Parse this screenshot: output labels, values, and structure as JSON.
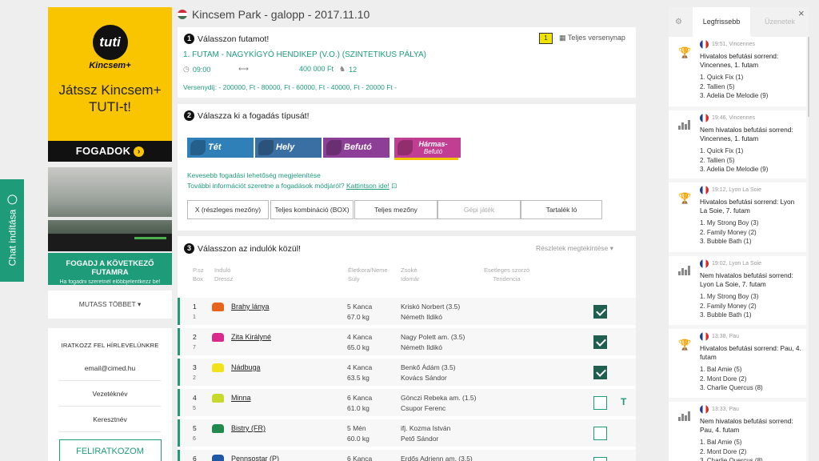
{
  "chat": {
    "label": "Chat indítása"
  },
  "ad": {
    "logo": "tuti",
    "brand": "Kincsem+",
    "slogan_line1": "Játssz Kincsem+",
    "slogan_line2": "TUTI-t!",
    "cta": "FOGADOK"
  },
  "bet_next": {
    "title": "FOGADJ A KÖVETKEZŐ FUTAMRA",
    "subtitle": "Ha fogadni szeretnél előbbjelentkezz be!"
  },
  "more": {
    "label": "MUTASS TÖBBET"
  },
  "newsletter": {
    "heading": "IRATKOZZ FEL HÍRLEVELÜNKRE",
    "email": "email@cimed.hu",
    "lastname": "Vezetéknév",
    "firstname": "Keresztnév",
    "submit": "FELIRATKOZOM"
  },
  "header": {
    "title": "Kincsem Park - galopp - 2017.11.10"
  },
  "step1": {
    "num": "1",
    "title": "Válasszon futamot!",
    "race_name": "1. FUTAM - NAGYKÍGYÓ HENDIKEP (V.O.) (SZINTETIKUS PÁLYA)",
    "badge": "1",
    "full_program": "Teljes versenynap",
    "time": "09:00",
    "prize": "400 000 Ft",
    "runners": "12",
    "prizes_text": "Versenydíj: - 200000, Ft - 80000, Ft - 60000, Ft - 40000, Ft - 20000 Ft -"
  },
  "step2": {
    "num": "2",
    "title": "Válaszza ki a fogadás típusát!",
    "types": [
      "Tét",
      "Hely",
      "Befutó",
      "Hármas-",
      "Befutó"
    ],
    "link1": "Kevesebb fogadási lehetőség megjelenítése",
    "link2_prefix": "További információt szeretne a fogadások módjáról?",
    "link2": "Kattintson ide!",
    "options": [
      "X (részleges mezőny)",
      "Teljes kombináció (BOX)",
      "Teljes mezőny",
      "Gépi játék",
      "Tartalék ló"
    ]
  },
  "step3": {
    "num": "3",
    "title": "Válasszon az indulók közül!",
    "details": "Részletek megtekintése",
    "headers": {
      "pszl": "P.sz",
      "box": "Box",
      "indulo": "Induló",
      "dressz": "Dressz",
      "kor": "Életkora/Neme",
      "suly": "Súly",
      "zsoke": "Zsoké",
      "idomar": "Idomár",
      "szorzo": "Esetleges szorzó",
      "tendencia": "Tendencia"
    },
    "runners": [
      {
        "num": "1",
        "box": "1",
        "name": "Brahy lánya",
        "age": "5 Kanca",
        "weight": "67.0 kg",
        "jockey": "Kriskó Norbert (3.5)",
        "trainer": "Németh Ildikó",
        "silk": "#e8631c",
        "checked": true
      },
      {
        "num": "2",
        "box": "7",
        "name": "Zita Királyné",
        "age": "4 Kanca",
        "weight": "65.0 kg",
        "jockey": "Nagy Polett am. (3.5)",
        "trainer": "Németh Ildikó",
        "silk": "#d9298a",
        "checked": true
      },
      {
        "num": "3",
        "box": "2",
        "name": "Nádbuga",
        "age": "4 Kanca",
        "weight": "63.5 kg",
        "jockey": "Benkő Ádám (3.5)",
        "trainer": "Kovács Sándor",
        "silk": "#f2e21a",
        "checked": true
      },
      {
        "num": "4",
        "box": "5",
        "name": "Minna",
        "age": "6 Kanca",
        "weight": "61.0 kg",
        "jockey": "Gönczi Rebeka am. (1.5)",
        "trainer": "Csupor Ferenc",
        "silk": "#c7d92a",
        "checked": false,
        "t": "T"
      },
      {
        "num": "5",
        "box": "6",
        "name": "Bistry (FR)",
        "age": "5 Mén",
        "weight": "60.0 kg",
        "jockey": "ifj. Kozma István",
        "trainer": "Pető Sándor",
        "silk": "#1f8a4c",
        "checked": false
      },
      {
        "num": "6",
        "box": "",
        "name": "Pennsostar (P)",
        "age": "6 Kanca",
        "weight": "",
        "jockey": "Erdős Adrienn am. (3.5)",
        "trainer": "",
        "silk": "#2257a8",
        "checked": false
      }
    ]
  },
  "right_panel": {
    "tab_latest": "Legfrissebb",
    "tab_messages": "Üzenetek",
    "feed": [
      {
        "icon": "trophy-icon",
        "time": "19:51, Vincennes",
        "title": "Hivatalos befutási sorrend: Vincennes, 1. futam",
        "lines": [
          "1. Quick Fix (1)",
          "2. Tallien (5)",
          "3. Adelia De Melodie (9)"
        ]
      },
      {
        "icon": "bar-chart-icon",
        "time": "19:46, Vincennes",
        "title": "Nem hivatalos befutási sorrend: Vincennes, 1. futam",
        "lines": [
          "1. Quick Fix (1)",
          "2. Tallien (5)",
          "3. Adelia De Melodie (9)"
        ]
      },
      {
        "icon": "trophy-icon",
        "time": "19:12, Lyon La Soie",
        "title": "Hivatalos befutási sorrend: Lyon La Soie, 7. futam",
        "lines": [
          "1. My Strong Boy (3)",
          "2. Family Money (2)",
          "3. Bubble Bath (1)"
        ]
      },
      {
        "icon": "bar-chart-icon",
        "time": "19:02, Lyon La Soie",
        "title": "Nem hivatalos befutási sorrend: Lyon La Soie, 7. futam",
        "lines": [
          "1. My Strong Boy (3)",
          "2. Family Money (2)",
          "3. Bubble Bath (1)"
        ]
      },
      {
        "icon": "trophy-icon",
        "time": "13:38, Pau",
        "title": "Hivatalos befutási sorrend: Pau, 4. futam",
        "lines": [
          "1. Bal Amie (5)",
          "2. Mont Dore (2)",
          "3. Charlie Quercus (8)"
        ]
      },
      {
        "icon": "bar-chart-icon",
        "time": "13:33, Pau",
        "title": "Nem hivatalos befutási sorrend: Pau, 4. futam",
        "lines": [
          "1. Bal Amie (5)",
          "2. Mont Dore (2)",
          "3. Charlie Quercus (8)"
        ]
      }
    ]
  }
}
